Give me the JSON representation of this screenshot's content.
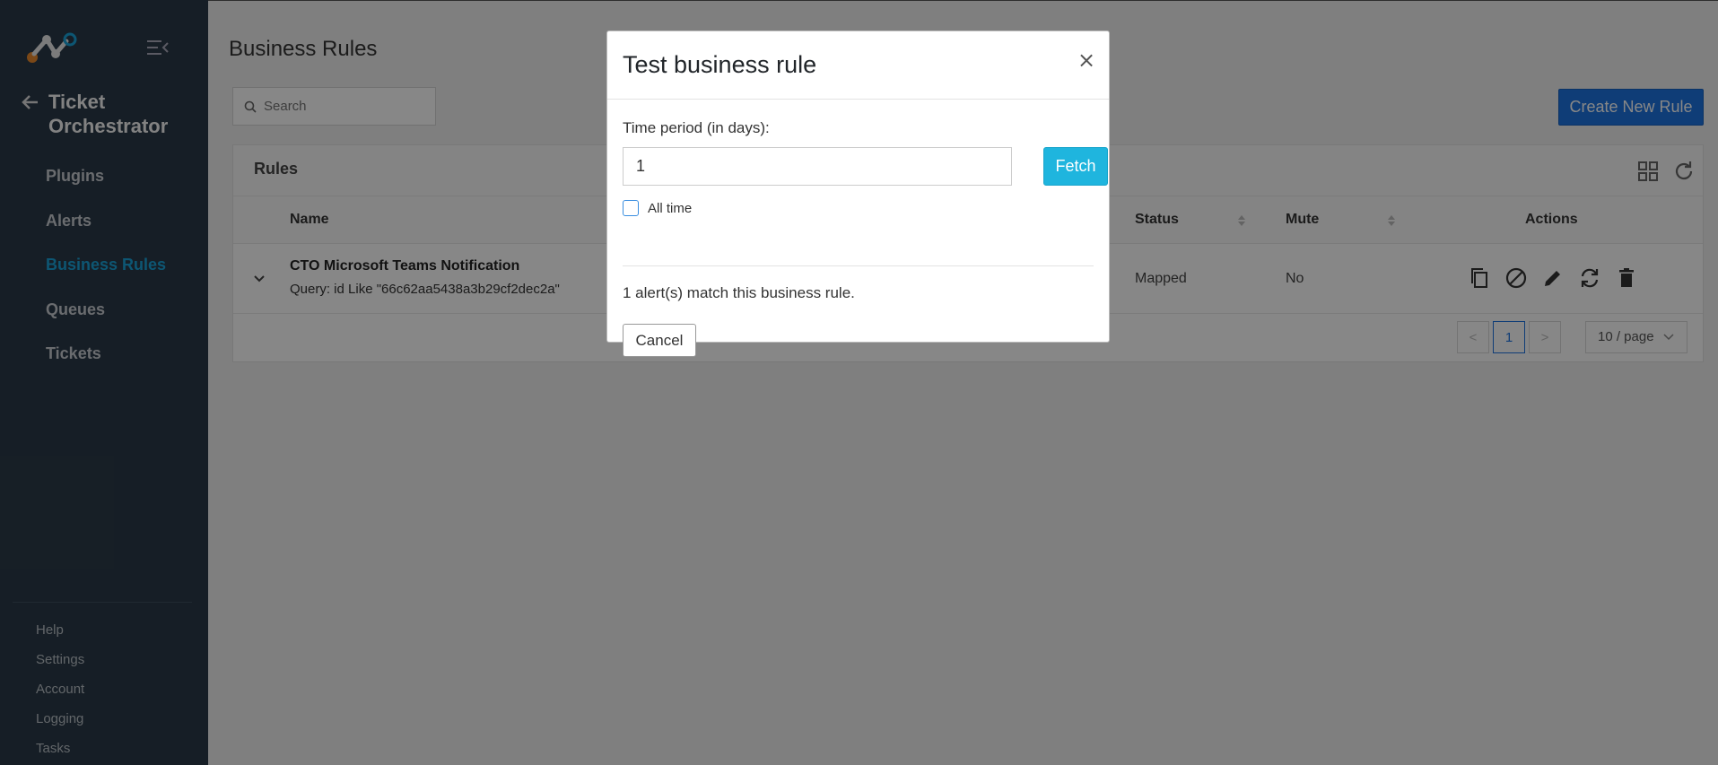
{
  "sidebar": {
    "app_title": "Ticket Orchestrator",
    "nav": [
      "Plugins",
      "Alerts",
      "Business Rules",
      "Queues",
      "Tickets"
    ],
    "active_nav": "Business Rules",
    "bottom": [
      "Help",
      "Settings",
      "Account",
      "Logging",
      "Tasks"
    ]
  },
  "main": {
    "page_title": "Business Rules",
    "search_placeholder": "Search",
    "create_button": "Create New Rule",
    "card_title": "Rules",
    "columns": {
      "name": "Name",
      "status": "Status",
      "mute": "Mute",
      "actions": "Actions"
    },
    "row": {
      "name": "CTO Microsoft Teams Notification",
      "query": "Query: id Like \"66c62aa5438a3b29cf2dec2a\"",
      "status": "Mapped",
      "mute": "No"
    },
    "pagination": {
      "prev": "<",
      "current": "1",
      "next": ">",
      "per_page": "10 / page"
    }
  },
  "modal": {
    "title": "Test business rule",
    "close": "×",
    "period_label": "Time period (in days):",
    "period_value": "1",
    "fetch_button": "Fetch",
    "all_time_label": "All time",
    "match_text": "1 alert(s) match this business rule.",
    "cancel_button": "Cancel"
  },
  "colors": {
    "sidebar_bg": "#2b3a48",
    "active_nav": "#1aa3d9",
    "primary": "#1e74e0",
    "fetch": "#1fb5de"
  }
}
